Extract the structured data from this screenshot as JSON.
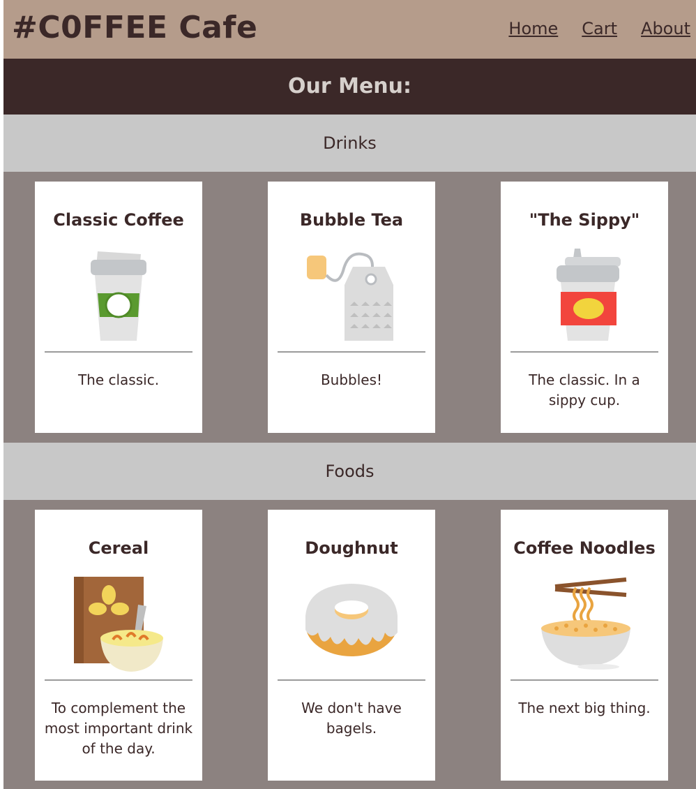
{
  "header": {
    "brand": "#C0FFEE Cafe",
    "nav": [
      "Home",
      "Cart",
      "About"
    ]
  },
  "banner": "Our Menu:",
  "sections": [
    {
      "title": "Drinks",
      "items": [
        {
          "name": "Classic Coffee",
          "desc": "The classic.",
          "icon": "coffee-cup-icon"
        },
        {
          "name": "Bubble Tea",
          "desc": "Bubbles!",
          "icon": "tea-bag-icon"
        },
        {
          "name": "\"The Sippy\"",
          "desc": "The classic. In a sippy cup.",
          "icon": "sippy-cup-icon"
        }
      ]
    },
    {
      "title": "Foods",
      "items": [
        {
          "name": "Cereal",
          "desc": "To complement the most important drink of the day.",
          "icon": "cereal-icon"
        },
        {
          "name": "Doughnut",
          "desc": "We don't have bagels.",
          "icon": "doughnut-icon"
        },
        {
          "name": "Coffee Noodles",
          "desc": "The next big thing.",
          "icon": "noodles-icon"
        }
      ]
    }
  ],
  "colors": {
    "header_bg": "#b59c8b",
    "banner_bg": "#3b2828",
    "section_bg": "#c8c8c8",
    "page_bg": "#8c8280",
    "text": "#3b2828"
  }
}
